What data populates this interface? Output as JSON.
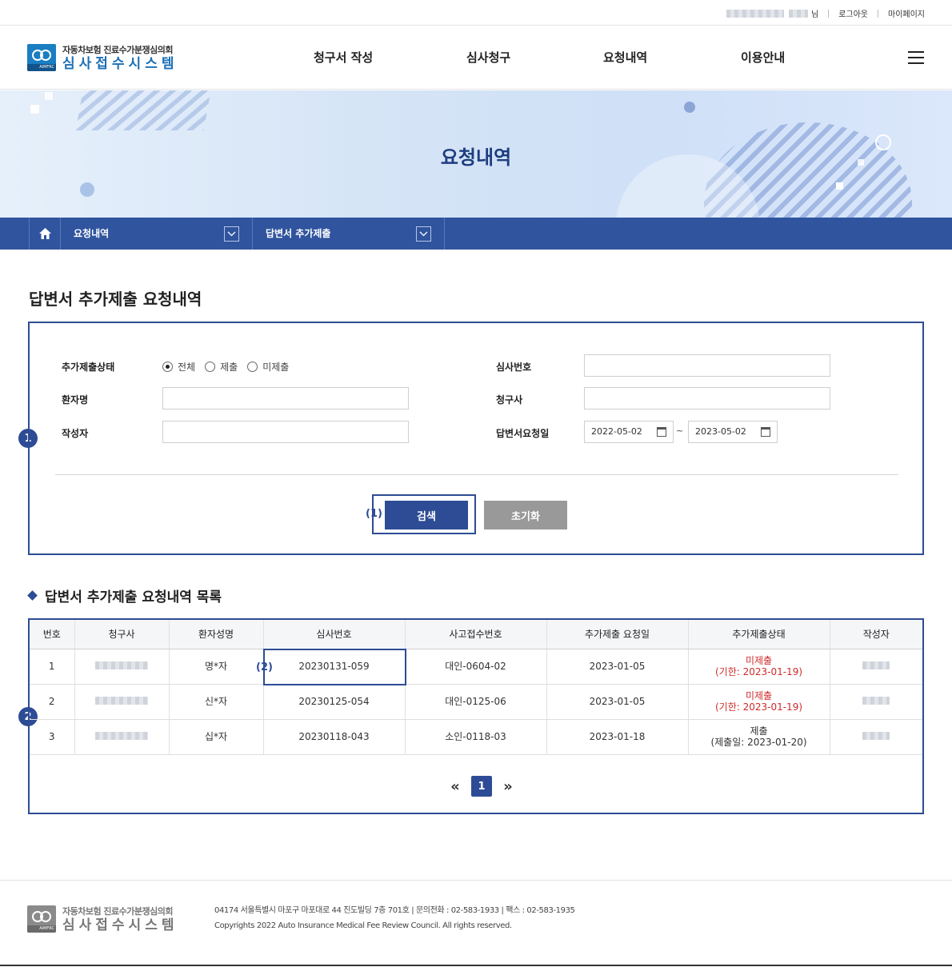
{
  "util": {
    "user_suffix": "님",
    "logout": "로그아웃",
    "mypage": "마이페이지"
  },
  "header": {
    "logo_line1": "자동차보험 진료수가분쟁심의회",
    "logo_line2": "심사접수시스템",
    "logo_abbr": "AIMFRC",
    "nav": [
      "청구서 작성",
      "심사청구",
      "요청내역",
      "이용안내"
    ]
  },
  "banner": {
    "title": "요청내역"
  },
  "location": {
    "depth1": "요청내역",
    "depth2": "답변서 추가제출"
  },
  "page_title": "답변서 추가제출 요청내역",
  "search": {
    "status_label": "추가제출상태",
    "status_options": [
      "전체",
      "제출",
      "미제출"
    ],
    "status_selected": "전체",
    "patient_label": "환자명",
    "writer_label": "작성자",
    "review_no_label": "심사번호",
    "claimant_label": "청구사",
    "request_date_label": "답변서요청일",
    "date_from": "2022-05-02",
    "date_sep": "~",
    "date_to": "2023-05-02",
    "search_button": "검색",
    "reset_button": "초기화",
    "highlight_label": "(1)",
    "section_badge": "1"
  },
  "list": {
    "title": "답변서 추가제출 요청내역 목록",
    "section_badge": "2",
    "highlight_label": "(2)",
    "columns": [
      "번호",
      "청구사",
      "환자성명",
      "심사번호",
      "사고접수번호",
      "추가제출 요청일",
      "추가제출상태",
      "작성자"
    ],
    "rows": [
      {
        "no": "1",
        "patient": "명*자",
        "review_no": "20230131-059",
        "accident_no": "대인-0604-02",
        "request_date": "2023-01-05",
        "status": "미제출",
        "status_detail": "(기한: 2023-01-19)",
        "status_color": "#d02a2a"
      },
      {
        "no": "2",
        "patient": "신*자",
        "review_no": "20230125-054",
        "accident_no": "대인-0125-06",
        "request_date": "2023-01-05",
        "status": "미제출",
        "status_detail": "(기한: 2023-01-19)",
        "status_color": "#d02a2a"
      },
      {
        "no": "3",
        "patient": "십*자",
        "review_no": "20230118-043",
        "accident_no": "소인-0118-03",
        "request_date": "2023-01-18",
        "status": "제출",
        "status_detail": "(제출일: 2023-01-20)",
        "status_color": "#333333"
      }
    ],
    "pager": {
      "prev": "«",
      "current": "1",
      "next": "»"
    }
  },
  "footer": {
    "logo_line1": "자동차보험 진료수가분쟁심의회",
    "logo_line2": "심사접수시스템",
    "logo_abbr": "AIMFRC",
    "address": "04174 서울특별시 마포구 마포대로 44 진도빌딩 7층 701호  |  문의전화 : 02-583-1933  |  팩스 : 02-583-1935",
    "copyright": "Copyrights 2022 Auto Insurance Medical Fee Review Council. All rights reserved."
  },
  "colors": {
    "primary": "#2d4c95",
    "location_bar": "#30549e",
    "alert": "#d02a2a"
  }
}
